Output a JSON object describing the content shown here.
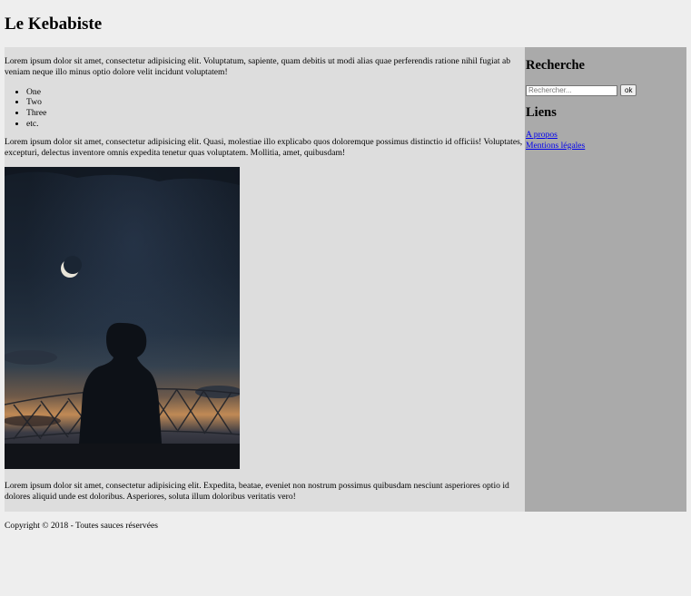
{
  "header": {
    "title": "Le Kebabiste"
  },
  "main": {
    "intro": "Lorem ipsum dolor sit amet, consectetur adipisicing elit. Voluptatum, sapiente, quam debitis ut modi alias quae perferendis ratione nihil fugiat ab veniam neque illo minus optio dolore velit incidunt voluptatem!",
    "list": [
      "One",
      "Two",
      "Three",
      "etc."
    ],
    "para2": "Lorem ipsum dolor sit amet, consectetur adipisicing elit. Quasi, molestiae illo explicabo quos doloremque possimus distinctio id officiis! Voluptates, excepturi, delectus inventore omnis expedita tenetur quas voluptatem. Mollitia, amet, quibusdam!",
    "para3": "Lorem ipsum dolor sit amet, consectetur adipisicing elit. Expedita, beatae, eveniet non nostrum possimus quibusdam nesciunt asperiores optio id dolores aliquid unde est doloribus. Asperiores, soluta illum doloribus veritatis vero!"
  },
  "sidebar": {
    "search_heading": "Recherche",
    "search_placeholder": "Rechercher...",
    "search_button": "ok",
    "links_heading": "Liens",
    "links": [
      "A propos",
      "Mentions légales"
    ]
  },
  "footer": {
    "copyright": "Copyright © 2018 - Toutes sauces réservées"
  },
  "colors": {
    "page_bg": "#eeeeee",
    "main_bg": "#dddddd",
    "sidebar_bg": "#aaaaaa",
    "link": "#0000ee"
  }
}
